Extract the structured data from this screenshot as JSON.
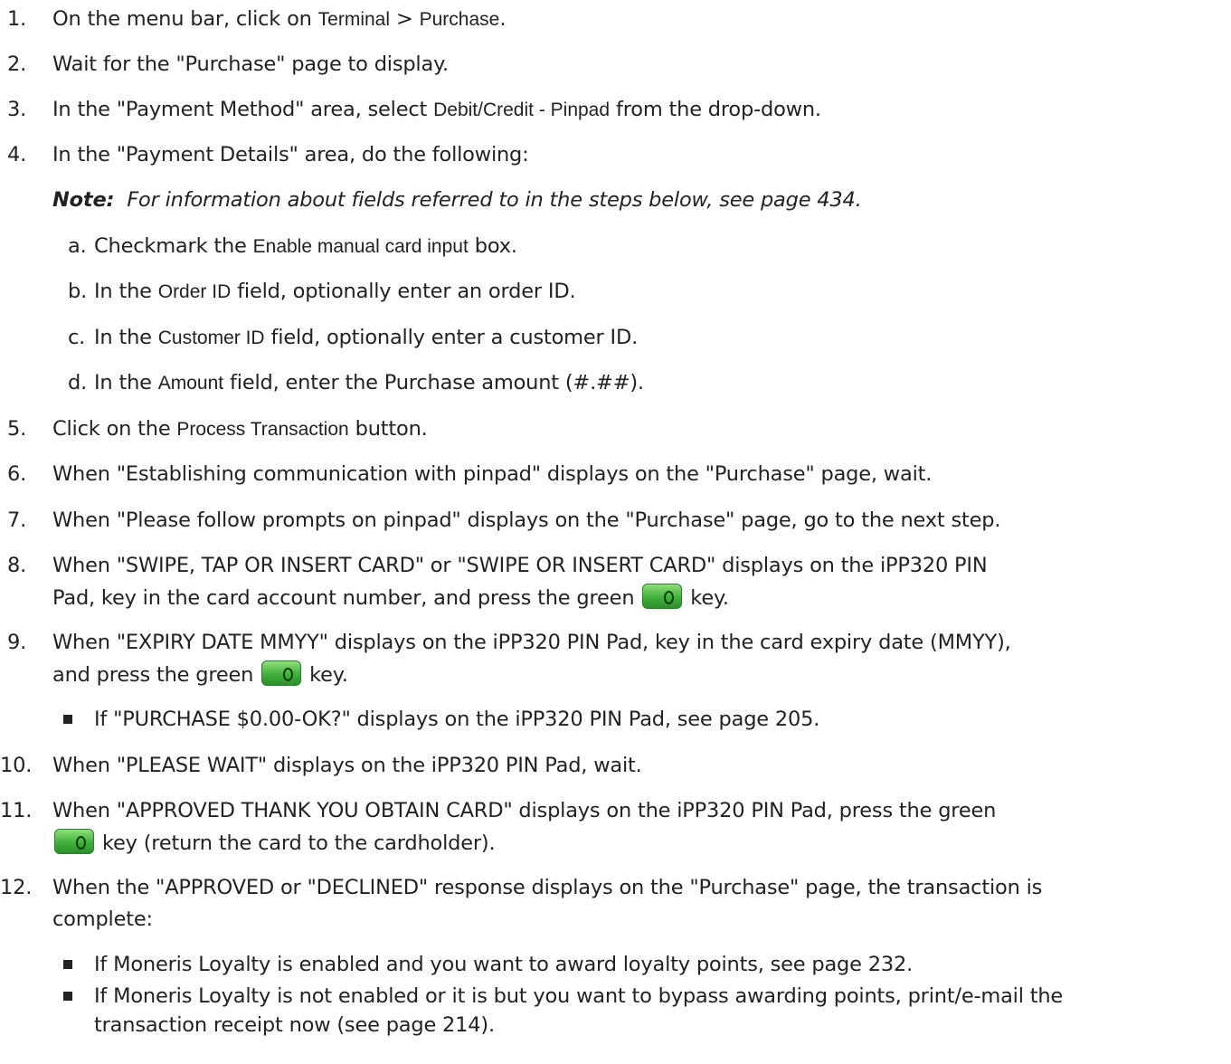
{
  "steps": [
    {
      "num": "1.",
      "pre": "On the menu bar, click on ",
      "ui1": "Terminal",
      "mid": " > ",
      "ui2": "Purchase",
      "post": "."
    },
    {
      "num": "2.",
      "text": "Wait for the \"Purchase\" page to display."
    },
    {
      "num": "3.",
      "pre": "In the \"Payment Method\" area, select ",
      "ui": "Debit/Credit - Pinpad",
      "post": " from the drop-down."
    },
    {
      "num": "4.",
      "text": "In the \"Payment Details\" area, do the following:"
    },
    {
      "num": "5.",
      "pre": "Click on the ",
      "ui": "Process Transaction",
      "post": " button."
    },
    {
      "num": "6.",
      "text": "When \"Establishing communication with pinpad\" displays on the \"Purchase\" page, wait."
    },
    {
      "num": "7.",
      "text": "When \"Please follow prompts on pinpad\" displays on the \"Purchase\" page, go to the next step."
    },
    {
      "num": "8.",
      "line1": "When \"SWIPE, TAP OR INSERT CARD\" or \"SWIPE OR INSERT CARD\" displays on the iPP320 PIN",
      "line2_pre": "Pad, key in the card account number, and press the green ",
      "line2_post": " key."
    },
    {
      "num": "9.",
      "line1": "When \"EXPIRY DATE MMYY\" displays on the iPP320 PIN Pad, key in the card expiry date (MMYY),",
      "line2_pre": "and press the green ",
      "line2_post": " key."
    },
    {
      "num": "10.",
      "text": "When \"PLEASE WAIT\" displays on the iPP320 PIN Pad, wait."
    },
    {
      "num": "11.",
      "line1": "When \"APPROVED THANK YOU OBTAIN CARD\" displays on the iPP320 PIN Pad, press the green",
      "line2_post": " key (return the card to the cardholder)."
    },
    {
      "num": "12.",
      "line1": "When the \"APPROVED or \"DECLINED\" response displays on the \"Purchase\" page, the transaction is",
      "line2": "complete:"
    }
  ],
  "note": {
    "label": "Note:",
    "text": "For information about fields referred to in the steps below, see page 434."
  },
  "substeps": [
    {
      "letter": "a.",
      "pre": "Checkmark the ",
      "ui": "Enable manual card input",
      "post": " box."
    },
    {
      "letter": "b.",
      "pre": "In the ",
      "ui": "Order ID",
      "post": " field, optionally enter an order ID."
    },
    {
      "letter": "c.",
      "pre": "In the ",
      "ui": "Customer ID",
      "post": " field, optionally enter a customer ID."
    },
    {
      "letter": "d.",
      "pre": "In the ",
      "ui": "Amount",
      "post": " field, enter the Purchase amount (#.##)."
    }
  ],
  "bullets": {
    "step9": "If \"PURCHASE $0.00-OK?\" displays on the iPP320 PIN Pad, see page 205.",
    "step12a": "If Moneris Loyalty is enabled and you want to award loyalty points, see page 232.",
    "step12b_line1": "If Moneris Loyalty is not enabled or it is but you want to bypass awarding points, print/e-mail the",
    "step12b_line2": "transaction receipt now (see page 214)."
  },
  "icons": {
    "green_key": "green-ok-key-icon"
  },
  "colors": {
    "text": "#222222",
    "key_green": "#3fb13a"
  }
}
